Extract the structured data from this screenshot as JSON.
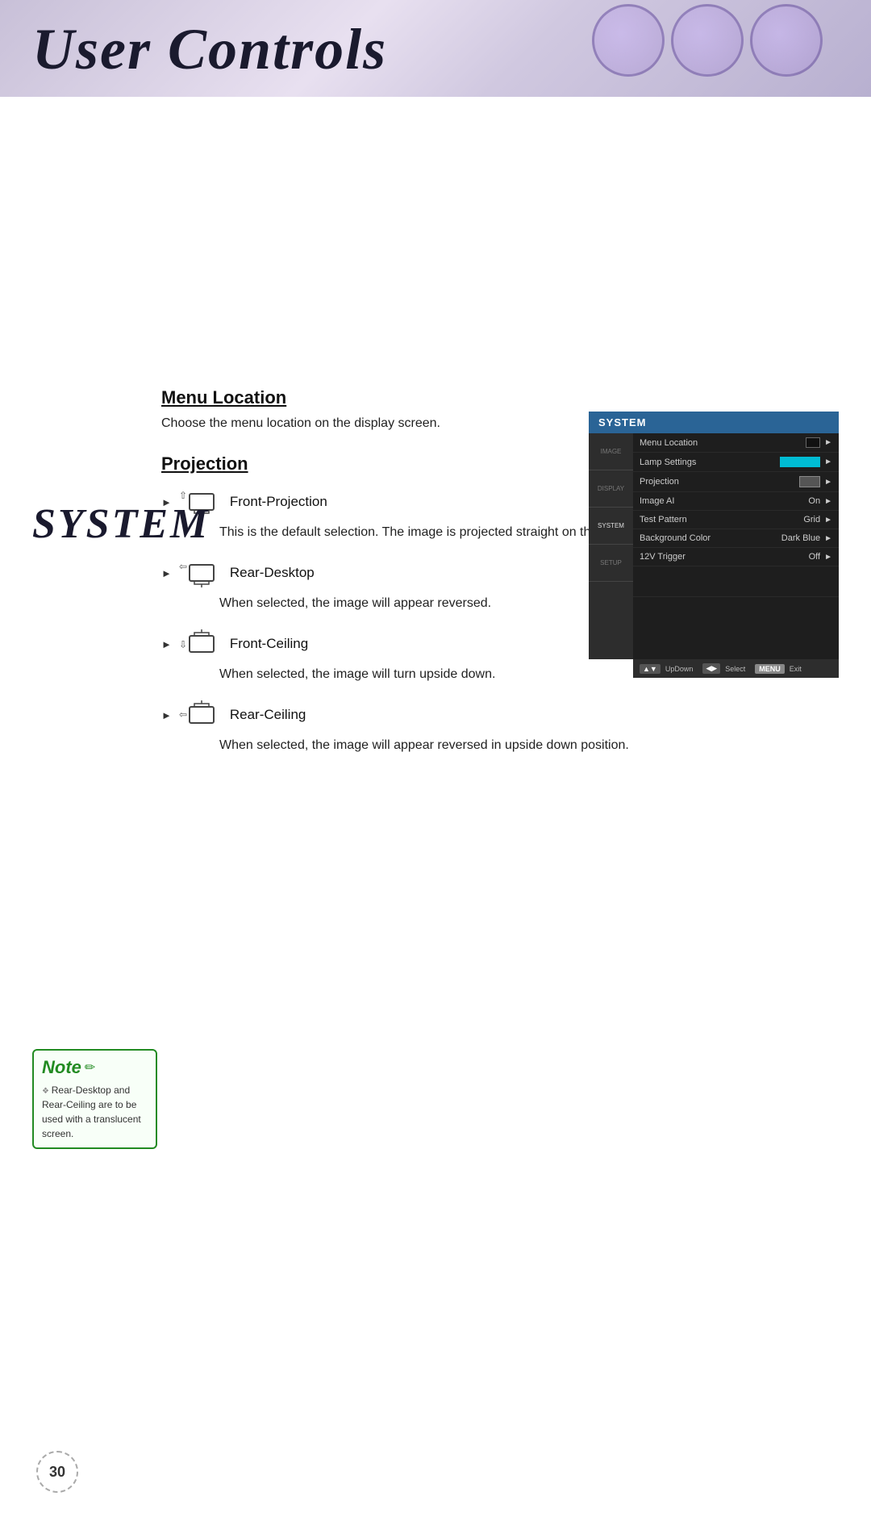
{
  "header": {
    "title": "User Controls",
    "deco_circles": 3
  },
  "system_label": "SYSTEM",
  "osd": {
    "title": "SYSTEM",
    "sidebar_items": [
      {
        "label": "IMAGE",
        "active": false
      },
      {
        "label": "DISPLAY",
        "active": false
      },
      {
        "label": "SYSTEM",
        "active": true
      },
      {
        "label": "SETUP",
        "active": false
      }
    ],
    "rows": [
      {
        "label": "Menu Location",
        "value": "",
        "swatch": "black",
        "has_arrow": true
      },
      {
        "label": "Lamp Settings",
        "value": "",
        "swatch": "teal",
        "has_arrow": true
      },
      {
        "label": "Projection",
        "value": "",
        "swatch": "gray",
        "has_arrow": true
      },
      {
        "label": "Image AI",
        "value": "On",
        "swatch": "",
        "has_arrow": true
      },
      {
        "label": "Test Pattern",
        "value": "Grid",
        "swatch": "",
        "has_arrow": true
      },
      {
        "label": "Background Color",
        "value": "Dark Blue",
        "swatch": "",
        "has_arrow": true
      },
      {
        "label": "12V Trigger",
        "value": "Off",
        "swatch": "",
        "has_arrow": true
      }
    ],
    "footer": {
      "updown_label": "UpDown",
      "select_label": "Select",
      "menu_label": "MENU",
      "exit_label": "Exit"
    }
  },
  "sections": {
    "menu_location": {
      "title": "Menu Location",
      "description": "Choose the menu location on the display screen."
    },
    "projection": {
      "title": "Projection",
      "items": [
        {
          "label": "Front-Projection",
          "description": "This is the default selection. The image is projected straight on the screen."
        },
        {
          "label": "Rear-Desktop",
          "description": "When selected, the image will appear reversed."
        },
        {
          "label": "Front-Ceiling",
          "description": "When selected, the image will turn upside down."
        },
        {
          "label": "Rear-Ceiling",
          "description": "When selected, the image will appear reversed in upside down position."
        }
      ]
    }
  },
  "note": {
    "title": "Note",
    "bullets": [
      "Rear-Desktop and Rear-Ceiling are to be used with a translucent screen."
    ]
  },
  "page_number": "30"
}
